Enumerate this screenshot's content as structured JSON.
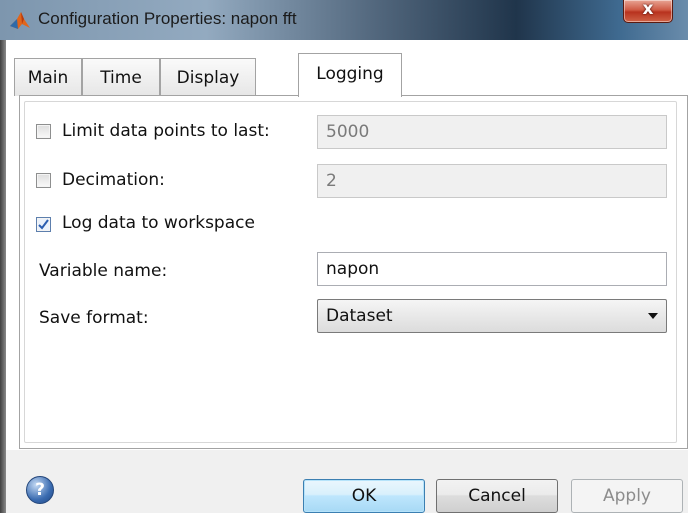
{
  "window": {
    "title": "Configuration Properties: napon fft",
    "close_label": "x"
  },
  "tabs": [
    {
      "label": "Main",
      "active": false
    },
    {
      "label": "Time",
      "active": false
    },
    {
      "label": "Display",
      "active": false
    },
    {
      "label": "Logging",
      "active": true
    }
  ],
  "logging": {
    "limit_points": {
      "label": "Limit data points to last:",
      "checked": false,
      "value": "5000"
    },
    "decimation": {
      "label": "Decimation:",
      "checked": false,
      "value": "2"
    },
    "log_to_workspace": {
      "label": "Log data to workspace",
      "checked": true
    },
    "variable_name": {
      "label": "Variable name:",
      "value": "napon"
    },
    "save_format": {
      "label": "Save format:",
      "value": "Dataset"
    }
  },
  "buttons": {
    "help": "?",
    "ok": "OK",
    "cancel": "Cancel",
    "apply": "Apply"
  },
  "colors": {
    "accent_check": "#2a5db0",
    "matlab_icon": "#e1651a"
  }
}
